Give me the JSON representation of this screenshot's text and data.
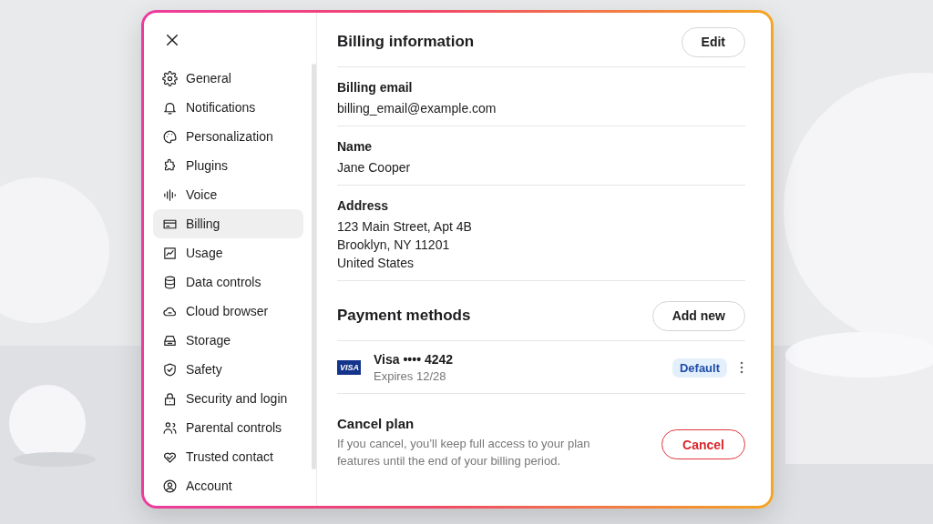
{
  "sidebar": {
    "items": [
      {
        "label": "General",
        "selected": false
      },
      {
        "label": "Notifications",
        "selected": false
      },
      {
        "label": "Personalization",
        "selected": false
      },
      {
        "label": "Plugins",
        "selected": false
      },
      {
        "label": "Voice",
        "selected": false
      },
      {
        "label": "Billing",
        "selected": true
      },
      {
        "label": "Usage",
        "selected": false
      },
      {
        "label": "Data controls",
        "selected": false
      },
      {
        "label": "Cloud browser",
        "selected": false
      },
      {
        "label": "Storage",
        "selected": false
      },
      {
        "label": "Safety",
        "selected": false
      },
      {
        "label": "Security and login",
        "selected": false
      },
      {
        "label": "Parental controls",
        "selected": false
      },
      {
        "label": "Trusted contact",
        "selected": false
      },
      {
        "label": "Account",
        "selected": false
      }
    ]
  },
  "billing_information": {
    "title": "Billing information",
    "edit_button": "Edit",
    "fields": [
      {
        "label": "Billing email",
        "lines": [
          "billing_email@example.com"
        ]
      },
      {
        "label": "Name",
        "lines": [
          "Jane Cooper"
        ]
      },
      {
        "label": "Address",
        "lines": [
          "123 Main Street, Apt 4B",
          "Brooklyn, NY  11201",
          "United States"
        ]
      }
    ]
  },
  "payment_methods": {
    "title": "Payment methods",
    "add_button": "Add new",
    "cards": [
      {
        "brand_logo": "VISA",
        "name": "Visa •••• 4242",
        "expiry": "Expires 12/28",
        "badge": "Default"
      }
    ]
  },
  "cancel_plan": {
    "title": "Cancel plan",
    "description": "If you cancel, you’ll keep full access to your plan features until the end of your billing period.",
    "button": "Cancel"
  }
}
